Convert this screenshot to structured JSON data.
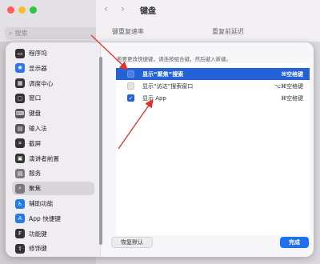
{
  "background_window": {
    "search_placeholder": "搜索",
    "title": "键盘",
    "header_left": "键重复速率",
    "header_right": "重复前延迟"
  },
  "sidebar": {
    "items": [
      {
        "label": "程序坞",
        "icon": "dock-icon",
        "color": "#333333",
        "glyph": "▭"
      },
      {
        "label": "显示器",
        "icon": "display-icon",
        "color": "#2a78f0",
        "glyph": "✹"
      },
      {
        "label": "调度中心",
        "icon": "mission-control-icon",
        "color": "#333333",
        "glyph": "▦"
      },
      {
        "label": "窗口",
        "icon": "window-icon",
        "color": "#333333",
        "glyph": "▢"
      },
      {
        "label": "键盘",
        "icon": "keyboard-icon",
        "color": "#555555",
        "glyph": "⌨"
      },
      {
        "label": "输入法",
        "icon": "input-method-icon",
        "color": "#555555",
        "glyph": "▤"
      },
      {
        "label": "截屏",
        "icon": "screenshot-icon",
        "color": "#333333",
        "glyph": "⌗"
      },
      {
        "label": "演讲者前置",
        "icon": "presenter-overlay-icon",
        "color": "#333333",
        "glyph": "▣"
      },
      {
        "label": "服务",
        "icon": "services-icon",
        "color": "#7a7a7e",
        "glyph": "▤"
      },
      {
        "label": "聚焦",
        "icon": "spotlight-icon",
        "color": "#7a7a7e",
        "glyph": "⌕"
      },
      {
        "label": "辅助功能",
        "icon": "accessibility-icon",
        "color": "#1e7cf0",
        "glyph": "♿"
      },
      {
        "label": "App 快捷键",
        "icon": "app-shortcuts-icon",
        "color": "#2a78f0",
        "glyph": "A"
      },
      {
        "label": "功能键",
        "icon": "function-keys-icon",
        "color": "#333333",
        "glyph": "F"
      },
      {
        "label": "修饰键",
        "icon": "modifier-keys-icon",
        "color": "#333333",
        "glyph": "⇧"
      }
    ],
    "selected_index": 9
  },
  "shortcuts": {
    "hint": "若要更改快捷键，请连按组合键，然后键入新键。",
    "rows": [
      {
        "label": "显示“聚焦”搜索",
        "key": "⌘空格键",
        "checked": false,
        "selected": true
      },
      {
        "label": "显示“访达”搜索窗口",
        "key": "⌥⌘空格键",
        "checked": false,
        "selected": false
      },
      {
        "label": "显示 App",
        "key": "⌘空格键",
        "checked": true,
        "selected": false
      }
    ]
  },
  "buttons": {
    "restore_default": "恢复默认",
    "done": "完成"
  },
  "colors": {
    "accent": "#2463d7",
    "annotation_arrow": "#e0302d"
  }
}
